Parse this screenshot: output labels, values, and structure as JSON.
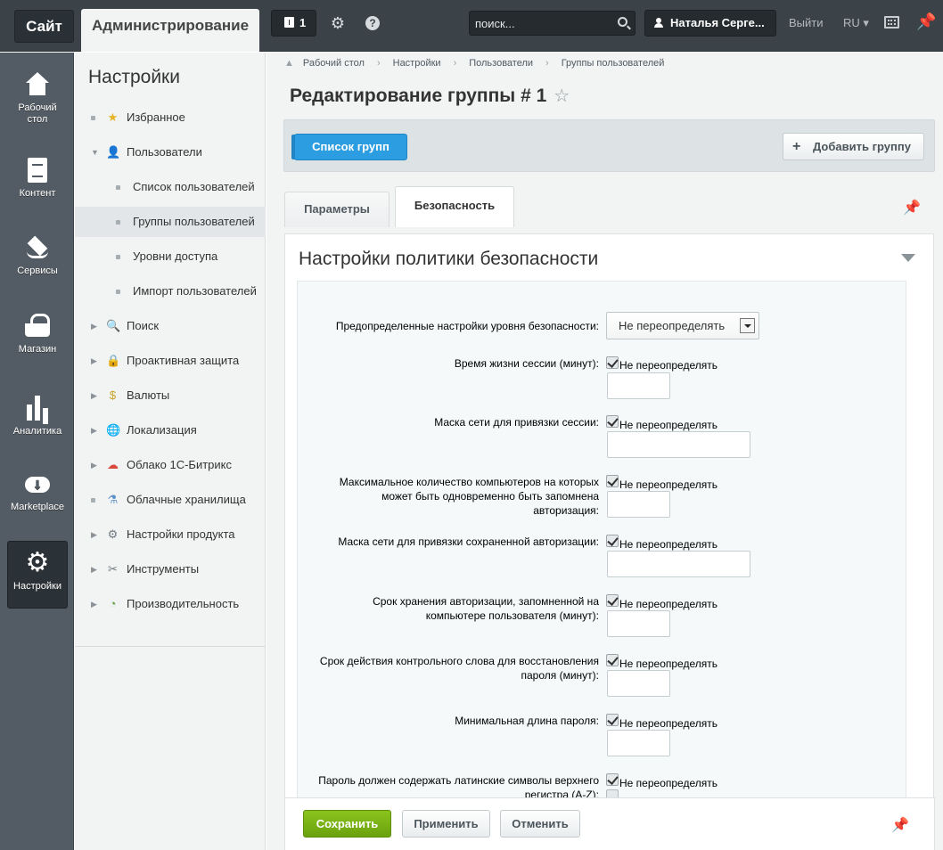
{
  "topbar": {
    "site_tab": "Сайт",
    "admin_tab": "Администрирование",
    "notifications_count": "1",
    "search_placeholder": "поиск...",
    "user_name": "Наталья Серге...",
    "logout": "Выйти",
    "language": "RU ▾"
  },
  "rail": [
    {
      "label": "Рабочий стол",
      "icon": "home-icon"
    },
    {
      "label": "Контент",
      "icon": "document-icon"
    },
    {
      "label": "Сервисы",
      "icon": "layers-icon"
    },
    {
      "label": "Магазин",
      "icon": "basket-icon"
    },
    {
      "label": "Аналитика",
      "icon": "bar-chart-icon"
    },
    {
      "label": "Marketplace",
      "icon": "cloud-download-icon"
    },
    {
      "label": "Настройки",
      "icon": "gear-icon"
    }
  ],
  "sidebar": {
    "title": "Настройки",
    "items": [
      {
        "label": "Избранное",
        "icon": "star-icon"
      },
      {
        "label": "Пользователи",
        "icon": "user-icon"
      },
      {
        "label": "Список пользователей"
      },
      {
        "label": "Группы пользователей"
      },
      {
        "label": "Уровни доступа"
      },
      {
        "label": "Импорт пользователей"
      },
      {
        "label": "Поиск",
        "icon": "magnifier-icon"
      },
      {
        "label": "Проактивная защита",
        "icon": "lock-icon"
      },
      {
        "label": "Валюты",
        "icon": "currency-icon"
      },
      {
        "label": "Локализация",
        "icon": "globe-icon"
      },
      {
        "label": "Облако 1С-Битрикс",
        "icon": "cloud-icon"
      },
      {
        "label": "Облачные хранилища",
        "icon": "flask-icon"
      },
      {
        "label": "Настройки продукта",
        "icon": "cog-icon"
      },
      {
        "label": "Инструменты",
        "icon": "tools-icon"
      },
      {
        "label": "Производительность",
        "icon": "speedometer-icon"
      }
    ]
  },
  "breadcrumbs": [
    "Рабочий стол",
    "Настройки",
    "Пользователи",
    "Группы пользователей"
  ],
  "page": {
    "title": "Редактирование группы # 1",
    "list_button": "Список групп",
    "add_button": "Добавить группу",
    "tabs": [
      "Параметры",
      "Безопасность"
    ],
    "section_title": "Настройки политики безопасности"
  },
  "form": {
    "preset_label": "Предопределенные настройки уровня безопасности:",
    "preset_value": "Не переопределять",
    "dont_override": "Не переопределять",
    "rows": [
      "Время жизни сессии (минут):",
      "Маска сети для привязки сессии:",
      "Максимальное количество компьютеров на которых может быть одновременно быть запомнена авторизация:",
      "Маска сети для привязки сохраненной авторизации:",
      "Срок хранения авторизации, запомненной на компьютере пользователя (минут):",
      "Срок действия контрольного слова для восстановления пароля (минут):",
      "Минимальная длина пароля:",
      "Пароль должен содержать латинские символы верхнего регистра (A-Z):"
    ]
  },
  "footer": {
    "save": "Сохранить",
    "apply": "Применить",
    "cancel": "Отменить"
  },
  "colors": {
    "topbar": "#3b4349",
    "rail": "#535c64",
    "primary_blue": "#2b9de0",
    "save_green": "#7bb316"
  }
}
